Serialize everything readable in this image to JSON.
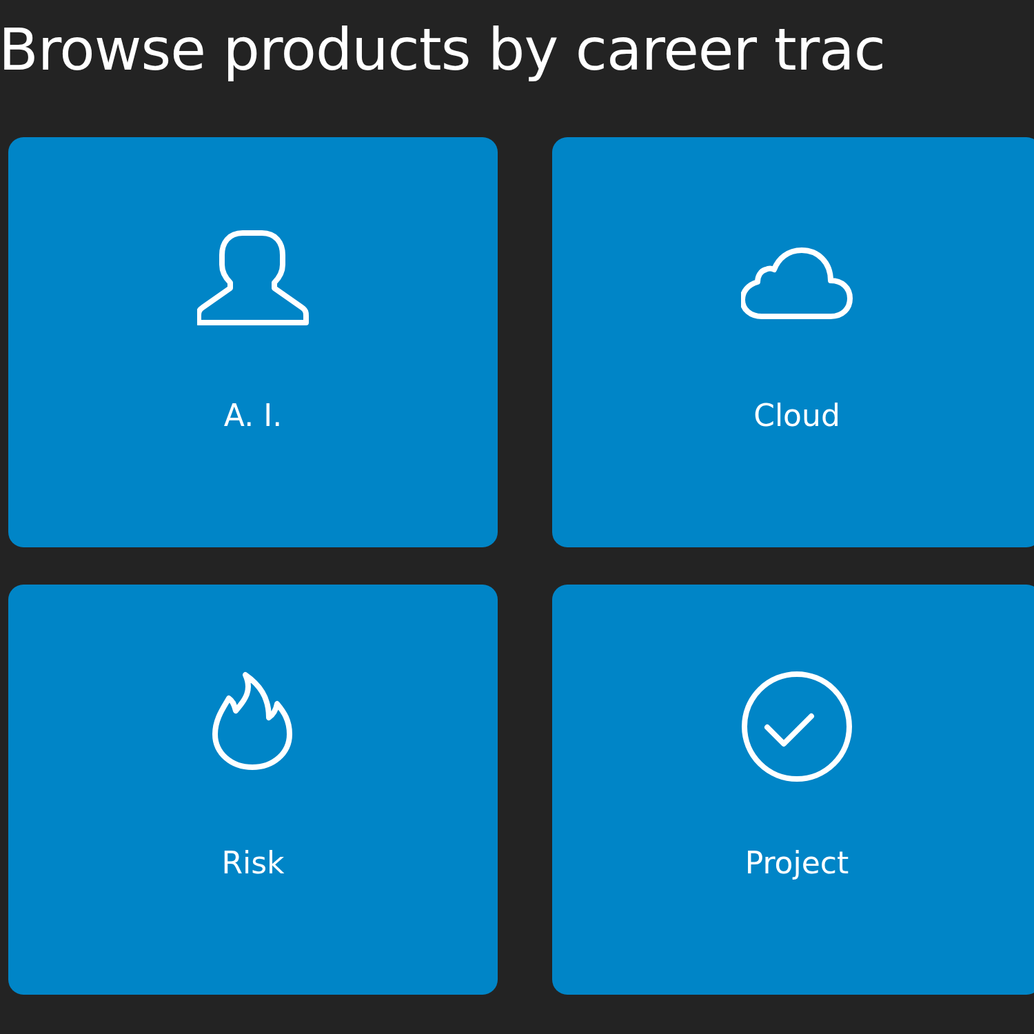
{
  "heading": "Browse products by career trac",
  "tracks": [
    {
      "label": "A. I."
    },
    {
      "label": "Cloud"
    },
    {
      "label": "Risk"
    },
    {
      "label": "Project"
    }
  ]
}
